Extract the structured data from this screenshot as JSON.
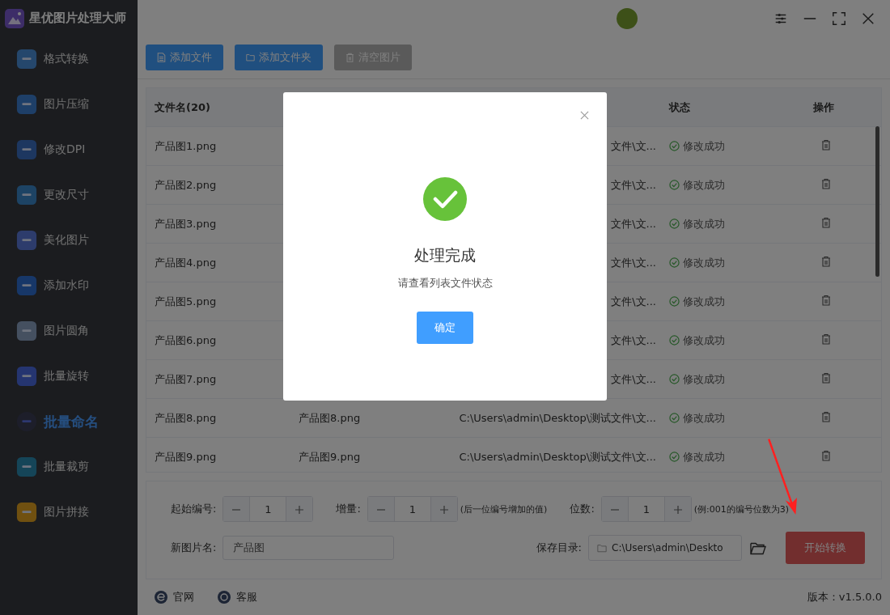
{
  "app": {
    "title": "星优图片处理大师"
  },
  "sidebar": {
    "items": [
      {
        "label": "格式转换",
        "selected": false
      },
      {
        "label": "图片压缩",
        "selected": false
      },
      {
        "label": "修改DPI",
        "selected": false
      },
      {
        "label": "更改尺寸",
        "selected": false
      },
      {
        "label": "美化图片",
        "selected": false
      },
      {
        "label": "添加水印",
        "selected": false
      },
      {
        "label": "图片圆角",
        "selected": false
      },
      {
        "label": "批量旋转",
        "selected": false
      },
      {
        "label": "批量命名",
        "selected": true
      },
      {
        "label": "批量裁剪",
        "selected": false
      },
      {
        "label": "图片拼接",
        "selected": false
      }
    ]
  },
  "toolbar": [
    {
      "label": "添加文件",
      "kind": "file"
    },
    {
      "label": "添加文件夹",
      "kind": "folder"
    },
    {
      "label": "清空图片",
      "kind": "clear"
    }
  ],
  "table": {
    "columns": [
      "文件名(20)",
      "状态",
      "操作"
    ],
    "rows": [
      {
        "name": "产品图1.png",
        "path": "文件\\文...",
        "status": "修改成功"
      },
      {
        "name": "产品图2.png",
        "path": "文件\\文...",
        "status": "修改成功"
      },
      {
        "name": "产品图3.png",
        "path": "文件\\文...",
        "status": "修改成功"
      },
      {
        "name": "产品图4.png",
        "path": "文件\\文...",
        "status": "修改成功"
      },
      {
        "name": "产品图5.png",
        "path": "文件\\文...",
        "status": "修改成功"
      },
      {
        "name": "产品图6.png",
        "path": "文件\\文...",
        "status": "修改成功"
      },
      {
        "name": "产品图7.png",
        "path": "文件\\文...",
        "status": "修改成功"
      },
      {
        "name": "产品图8.png",
        "new_name": "产品图8.png",
        "path": "C:\\Users\\admin\\Desktop\\测试文件\\文...",
        "status": "修改成功"
      },
      {
        "name": "产品图9.png",
        "new_name": "产品图9.png",
        "path": "C:\\Users\\admin\\Desktop\\测试文件\\文...",
        "status": "修改成功"
      }
    ]
  },
  "settings": {
    "steppers": [
      {
        "label": "起始编号:",
        "value": "1"
      },
      {
        "label": "增量:",
        "value": "1",
        "hint": "(后一位编号增加的值)"
      },
      {
        "label": "位数:",
        "value": "1",
        "hint": "(例:001的编号位数为3)"
      }
    ],
    "new_name_label": "新图片名:",
    "new_name": "产品图",
    "save_dir_label": "保存目录:",
    "save_dir": "C:\\Users\\admin\\Deskto",
    "start_button": "开始转换"
  },
  "footer": {
    "links": [
      {
        "label": "官网",
        "kind": "web"
      },
      {
        "label": "客服",
        "kind": "service"
      }
    ],
    "version": "版本：v1.5.0.0"
  },
  "dialog": {
    "title": "处理完成",
    "message": "请查看列表文件状态",
    "button": "确定"
  }
}
